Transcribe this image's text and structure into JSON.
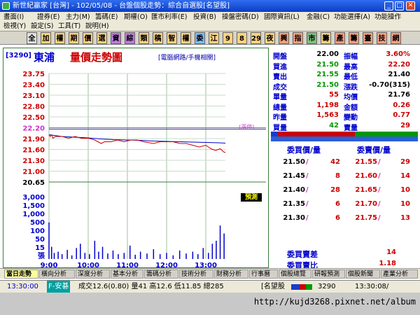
{
  "window": {
    "title": "新世紀贏家 [台灣] - 102/05/08 - 台盤個股走勢：綜合自選股[名望股]"
  },
  "menu": [
    [
      "畫面(I)",
      "證券(E)",
      "主力(M)",
      "籌碼(E)",
      "期權(O)",
      "匯市利率(E)",
      "投資(B)",
      "操盤密碼(D)",
      "國際資訊(L)",
      "金融(C)",
      "功能選擇(A)",
      "功能操作"
    ],
    [
      "檢視(Y)",
      "設定(S)",
      "工具(T)",
      "說明(H)"
    ]
  ],
  "toolbar": [
    "全",
    "加",
    "權",
    "期",
    "價",
    "選",
    "資",
    "綜",
    "類",
    "稿",
    "智",
    "權",
    "委",
    "江",
    "9",
    "8",
    "29",
    "夜",
    "興",
    "指",
    "市",
    "籌",
    "產",
    "籌",
    "臺",
    "技",
    "網"
  ],
  "stock": {
    "code": "[3290]",
    "name": "東浦",
    "chart_title": "量價走勢圖",
    "link": "[電腦網路/手機相關]"
  },
  "legend": {
    "limit_up": "(漲停)",
    "limit_down": "跌停"
  },
  "quote": [
    {
      "l1": "開盤",
      "v1": "22.00",
      "l2": "振幅",
      "v2": "3.60%",
      "c2": "#cc0000"
    },
    {
      "l1": "買進",
      "v1": "21.50",
      "l2": "最高",
      "v2": "22.20",
      "c2": "#cc0000"
    },
    {
      "l1": "賣出",
      "v1": "21.55",
      "l2": "最低",
      "v2": "21.40",
      "c2": "#000000"
    },
    {
      "l1": "成交",
      "v1": "21.50",
      "l2": "漲跌",
      "v2": "-0.70(315)",
      "c2": "#000000"
    },
    {
      "l1": "單量",
      "v1": "55",
      "l2": "均價",
      "v2": "21.76",
      "c2": "#000000"
    },
    {
      "l1": "總量",
      "v1": "1,198",
      "l2": "金額",
      "v2": "0.26",
      "c2": "#cc0000"
    },
    {
      "l1": "昨量",
      "v1": "1,563",
      "l2": "變動",
      "v2": "0.77",
      "c2": "#cc0000"
    },
    {
      "l1": "買量",
      "v1": "42",
      "l2": "賣量",
      "v2": "29",
      "c2": "#cc0000"
    }
  ],
  "orderbook": {
    "bid_header": "委買價/量",
    "ask_header": "委賣價/量",
    "bids": [
      [
        "21.50",
        "42"
      ],
      [
        "21.45",
        "8"
      ],
      [
        "21.40",
        "28"
      ],
      [
        "21.35",
        "6"
      ],
      [
        "21.30",
        "6"
      ]
    ],
    "asks": [
      [
        "21.55",
        "29"
      ],
      [
        "21.60",
        "14"
      ],
      [
        "21.65",
        "10"
      ],
      [
        "21.70",
        "10"
      ],
      [
        "21.75",
        "13"
      ]
    ],
    "diff_label": "委買賣差",
    "diff_value": "14",
    "ratio_label": "委買賣比",
    "ratio_value": "1.18"
  },
  "predict_label": "預測",
  "bottom_tabs": [
    "當日走勢",
    "橫向分析",
    "深度分析",
    "基本分析",
    "籌碼分析",
    "技術分析",
    "財務分析",
    "行事曆",
    "個股總覽",
    "研報預測",
    "個股新聞",
    "產業分析"
  ],
  "status": {
    "time": "13:30:00",
    "alert": "F-安碁",
    "text": "成交12.6(0.80) 量41 高12.6 低11.85 總285",
    "group": "[名望股",
    "code": "3290",
    "clock": "13:30:08/"
  },
  "footer": {
    "url": "http://kujd3268.pixnet.net/album"
  },
  "colors": {
    "up": "#cc0000",
    "down": "#009900",
    "label": "#0000cc",
    "chart_border": "#3a7f3a"
  },
  "chart_data": {
    "type": "line",
    "price_ticks": [
      "23.75",
      "23.40",
      "23.10",
      "22.80",
      "22.50",
      "22.20",
      "21.90",
      "21.60",
      "21.30",
      "21.00",
      "20.65"
    ],
    "volume_ticks": [
      "3,000",
      "1,500",
      "1,000",
      "500",
      "100",
      "50",
      "15",
      "張"
    ],
    "time_ticks": [
      "9:00",
      "10:00",
      "11:00",
      "12:00",
      "13:00"
    ],
    "prev_close": 22.2,
    "limit_up": 23.75,
    "limit_down": 20.65,
    "y_range": [
      20.65,
      23.75
    ],
    "x_range_minutes": [
      0,
      270
    ],
    "price_series": [
      [
        0,
        22.0
      ],
      [
        2,
        21.95
      ],
      [
        4,
        22.0
      ],
      [
        6,
        21.9
      ],
      [
        10,
        21.95
      ],
      [
        20,
        21.95
      ],
      [
        30,
        21.9
      ],
      [
        40,
        21.95
      ],
      [
        50,
        21.9
      ],
      [
        60,
        21.9
      ],
      [
        70,
        21.85
      ],
      [
        75,
        21.8
      ],
      [
        80,
        21.75
      ],
      [
        85,
        21.8
      ],
      [
        95,
        21.8
      ],
      [
        105,
        21.85
      ],
      [
        115,
        21.8
      ],
      [
        125,
        21.85
      ],
      [
        135,
        21.85
      ],
      [
        145,
        21.8
      ],
      [
        160,
        21.75
      ],
      [
        170,
        21.8
      ],
      [
        180,
        21.8
      ],
      [
        190,
        21.8
      ],
      [
        200,
        21.75
      ],
      [
        210,
        21.75
      ],
      [
        220,
        21.7
      ],
      [
        230,
        21.65
      ],
      [
        240,
        21.7
      ],
      [
        248,
        21.6
      ],
      [
        255,
        21.55
      ],
      [
        262,
        21.6
      ],
      [
        268,
        21.5
      ],
      [
        270,
        21.5
      ]
    ],
    "avg_series": [
      [
        0,
        22.0
      ],
      [
        20,
        21.95
      ],
      [
        40,
        21.93
      ],
      [
        60,
        21.91
      ],
      [
        80,
        21.88
      ],
      [
        100,
        21.86
      ],
      [
        120,
        21.85
      ],
      [
        140,
        21.84
      ],
      [
        160,
        21.82
      ],
      [
        180,
        21.81
      ],
      [
        200,
        21.8
      ],
      [
        220,
        21.79
      ],
      [
        240,
        21.78
      ],
      [
        260,
        21.77
      ],
      [
        270,
        21.76
      ]
    ],
    "volume_series": [
      [
        0,
        60
      ],
      [
        4,
        20
      ],
      [
        8,
        10
      ],
      [
        14,
        12
      ],
      [
        20,
        8
      ],
      [
        28,
        15
      ],
      [
        35,
        6
      ],
      [
        42,
        18
      ],
      [
        48,
        25
      ],
      [
        55,
        10
      ],
      [
        62,
        8
      ],
      [
        70,
        30
      ],
      [
        76,
        12
      ],
      [
        82,
        20
      ],
      [
        90,
        9
      ],
      [
        98,
        14
      ],
      [
        106,
        8
      ],
      [
        115,
        10
      ],
      [
        124,
        22
      ],
      [
        132,
        7
      ],
      [
        140,
        12
      ],
      [
        150,
        9
      ],
      [
        160,
        16
      ],
      [
        170,
        8
      ],
      [
        180,
        10
      ],
      [
        190,
        6
      ],
      [
        200,
        14
      ],
      [
        210,
        9
      ],
      [
        220,
        12
      ],
      [
        228,
        8
      ],
      [
        236,
        18
      ],
      [
        244,
        10
      ],
      [
        250,
        25
      ],
      [
        256,
        30
      ],
      [
        262,
        55
      ],
      [
        268,
        42
      ]
    ]
  }
}
